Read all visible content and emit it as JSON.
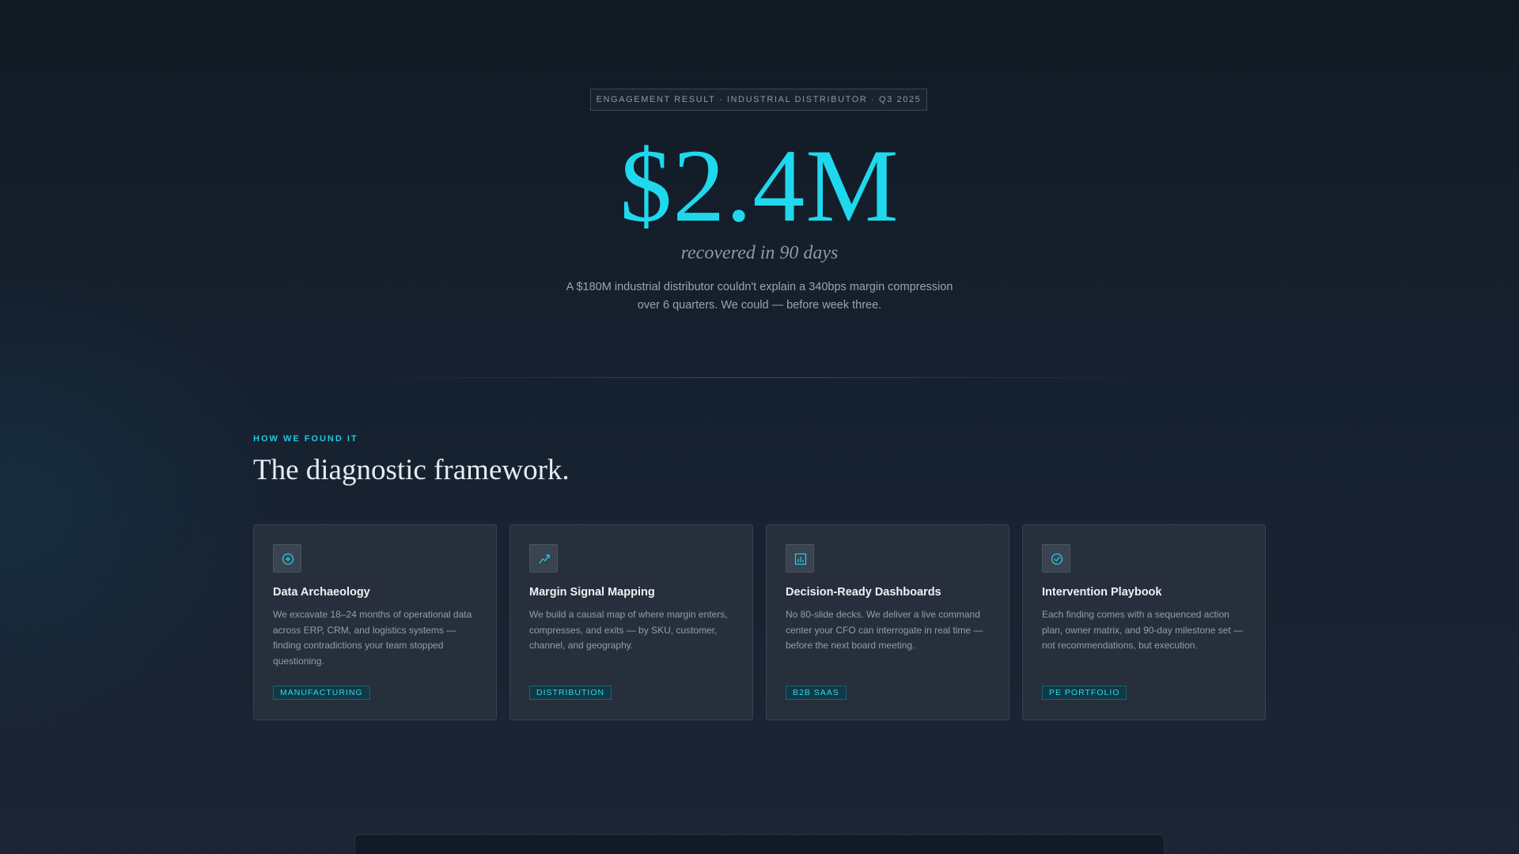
{
  "hero": {
    "eyebrow": "ENGAGEMENT RESULT · INDUSTRIAL DISTRIBUTOR · Q3 2025",
    "headline_value": "$2.4M",
    "subtitle": "recovered in 90 days",
    "lede": "A $180M industrial distributor couldn't explain a 340bps margin compression over 6 quarters. We could — before week three."
  },
  "section": {
    "kicker": "HOW WE FOUND IT",
    "title": "The diagnostic framework."
  },
  "cards": [
    {
      "icon": "plus-circle-icon",
      "title": "Data Archaeology",
      "body": "We excavate 18–24 months of operational data across ERP, CRM, and logistics systems — finding contradictions your team stopped questioning.",
      "tag": "MANUFACTURING"
    },
    {
      "icon": "trend-up-icon",
      "title": "Margin Signal Mapping",
      "body": "We build a causal map of where margin enters, compresses, and exits — by SKU, customer, channel, and geography.",
      "tag": "DISTRIBUTION"
    },
    {
      "icon": "bar-chart-icon",
      "title": "Decision-Ready Dashboards",
      "body": "No 80-slide decks. We deliver a live command center your CFO can interrogate in real time — before the next board meeting.",
      "tag": "B2B SAAS"
    },
    {
      "icon": "check-circle-icon",
      "title": "Intervention Playbook",
      "body": "Each finding comes with a sequenced action plan, owner matrix, and 90-day milestone set — not recommendations, but execution.",
      "tag": "PE PORTFOLIO"
    }
  ],
  "colors": {
    "accent": "#1fd8ee",
    "background": "#141e2a",
    "card": "#272f3c"
  }
}
